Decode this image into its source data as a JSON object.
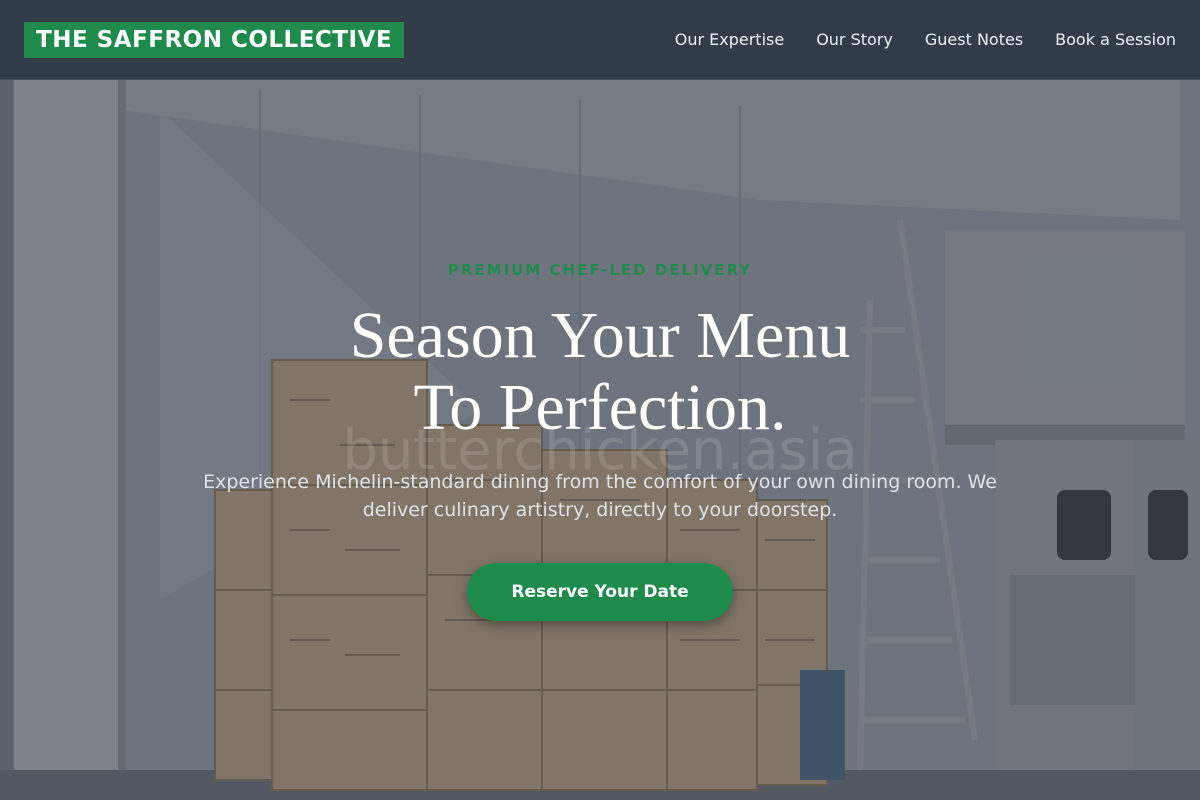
{
  "brand": {
    "name": "THE SAFFRON COLLECTIVE",
    "color": "#1e8a4c"
  },
  "nav": {
    "items": [
      {
        "label": "Our Expertise"
      },
      {
        "label": "Our Story"
      },
      {
        "label": "Guest Notes"
      },
      {
        "label": "Book a Session"
      }
    ]
  },
  "hero": {
    "eyebrow": "PREMIUM CHEF-LED DELIVERY",
    "headline_line1": "Season Your Menu",
    "headline_line2": "To Perfection.",
    "subtext": "Experience Michelin-standard dining from the comfort of your own dining room. We deliver culinary artistry, directly to your doorstep.",
    "cta_label": "Reserve Your Date",
    "watermark": "butterchicken.asia",
    "background_image": "warehouse-boxes-photo"
  },
  "colors": {
    "accent": "#1e8a4c",
    "header_bg": "#323c49"
  }
}
